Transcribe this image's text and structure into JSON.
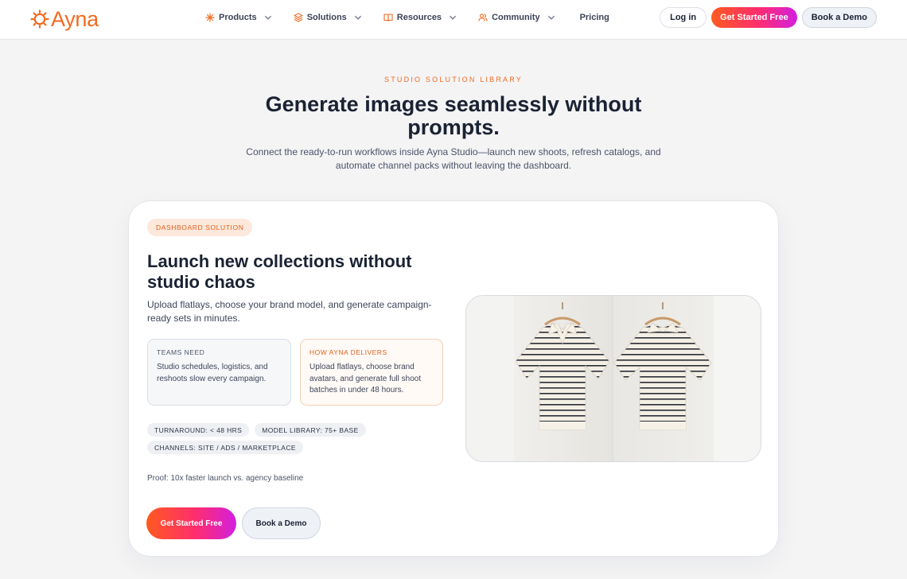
{
  "nav": {
    "brand": "Ayna",
    "items": [
      {
        "label": "Products",
        "icon": "sparkle-icon",
        "has_dropdown": true
      },
      {
        "label": "Solutions",
        "icon": "layers-icon",
        "has_dropdown": true
      },
      {
        "label": "Resources",
        "icon": "book-open-icon",
        "has_dropdown": true
      },
      {
        "label": "Community",
        "icon": "users-icon",
        "has_dropdown": true
      },
      {
        "label": "Pricing",
        "has_dropdown": false
      }
    ],
    "login": "Log in",
    "get_started": "Get Started Free",
    "book_demo": "Book a Demo"
  },
  "hero": {
    "eyebrow": "STUDIO SOLUTION LIBRARY",
    "title": "Generate images seamlessly without prompts.",
    "subtitle": "Connect the ready-to-run workflows inside Ayna Studio—launch new shoots, refresh catalogs, and automate channel packs without leaving the dashboard."
  },
  "card": {
    "badge": "DASHBOARD SOLUTION",
    "title": "Launch new collections without studio chaos",
    "description": "Upload flatlays, choose your brand model, and generate campaign-ready sets in minutes.",
    "teams_need": {
      "label": "TEAMS NEED",
      "text": "Studio schedules, logistics, and reshoots slow every campaign."
    },
    "ayna_delivers": {
      "label": "HOW AYNA DELIVERS",
      "text": "Upload flatlays, choose brand avatars, and generate full shoot batches in under 48 hours."
    },
    "chips": [
      "TURNAROUND: < 48 HRS",
      "MODEL LIBRARY: 75+ BASE",
      "CHANNELS: SITE / ADS / MARKETPLACE"
    ],
    "proof": "Proof: 10x faster launch vs. agency baseline",
    "cta_primary": "Get Started Free",
    "cta_secondary": "Book a Demo"
  },
  "colors": {
    "accent": "#f26a21",
    "gradient_start": "#ff5a1f",
    "gradient_end": "#d21fe0",
    "text": "#1a2233"
  }
}
